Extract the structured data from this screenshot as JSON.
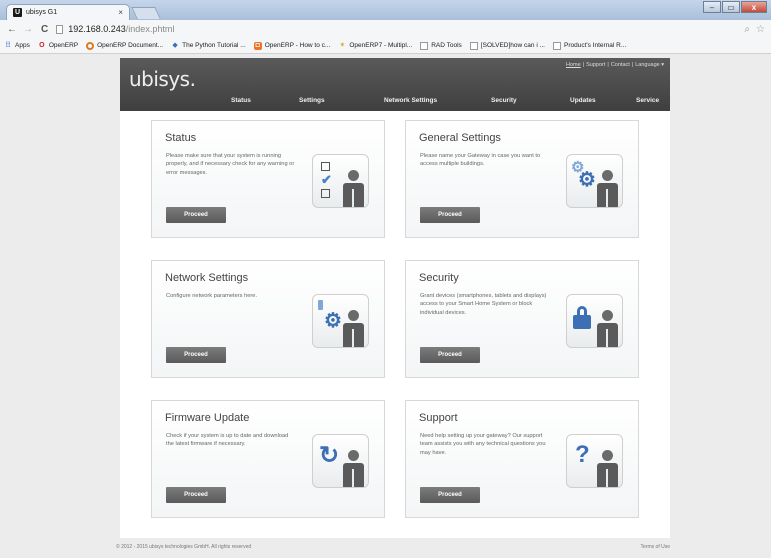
{
  "browser": {
    "tab_title": "ubisys G1",
    "tab_favicon": "U",
    "tab_close": "×",
    "url_host": "192.168.0.243",
    "url_path": "/index.phtml",
    "window_controls": [
      "–",
      "▭",
      "x"
    ],
    "bookmarks": [
      {
        "label": "Apps",
        "icon": "apps-grid-icon"
      },
      {
        "label": "OpenERP",
        "icon": "opera-icon"
      },
      {
        "label": "OpenERP Document...",
        "icon": "openerp-icon"
      },
      {
        "label": "The Python Tutorial ...",
        "icon": "python-icon"
      },
      {
        "label": "OpenERP - How to c...",
        "icon": "openerp-orange-icon"
      },
      {
        "label": "OpenERP7 - Multipl...",
        "icon": "wings-icon"
      },
      {
        "label": "RAD Tools",
        "icon": "page-icon"
      },
      {
        "label": "[SOLVED]how can i ...",
        "icon": "page-icon"
      },
      {
        "label": "Product's Internal R...",
        "icon": "page-icon"
      }
    ]
  },
  "header": {
    "logo": "ubisys.",
    "toplinks": {
      "home": "Home",
      "support": "Support",
      "contact": "Contact",
      "language": "Language ▾",
      "separator": "|"
    },
    "nav": [
      "Status",
      "Settings",
      "Network Settings",
      "Security",
      "Updates",
      "Service"
    ]
  },
  "cards": [
    {
      "title": "Status",
      "text": "Please make sure that your system is running properly, and if necessary check for any warning or error messages.",
      "button": "Proceed",
      "icon": "checklist-person-icon"
    },
    {
      "title": "General Settings",
      "text": "Please name your Gateway in case you want to access multiple buildings.",
      "button": "Proceed",
      "icon": "gears-person-icon"
    },
    {
      "title": "Network Settings",
      "text": "Configure network parameters here.",
      "button": "Proceed",
      "icon": "network-gear-person-icon"
    },
    {
      "title": "Security",
      "text": "Grant devices (smartphones, tablets and displays) access to your Smart Home System or block individual devices.",
      "button": "Proceed",
      "icon": "lock-person-icon"
    },
    {
      "title": "Firmware Update",
      "text": "Check if your system is up to date and download the latest firmware if necessary.",
      "button": "Proceed",
      "icon": "refresh-person-icon"
    },
    {
      "title": "Support",
      "text": "Need help setting up your gateway? Our support team assists you with any technical questions you may have.",
      "button": "Proceed",
      "icon": "question-person-icon"
    }
  ],
  "footer": {
    "copyright": "© 2012 - 2015 ubisys technologies GmbH. All rights reserved",
    "terms": "Terms of Use"
  }
}
